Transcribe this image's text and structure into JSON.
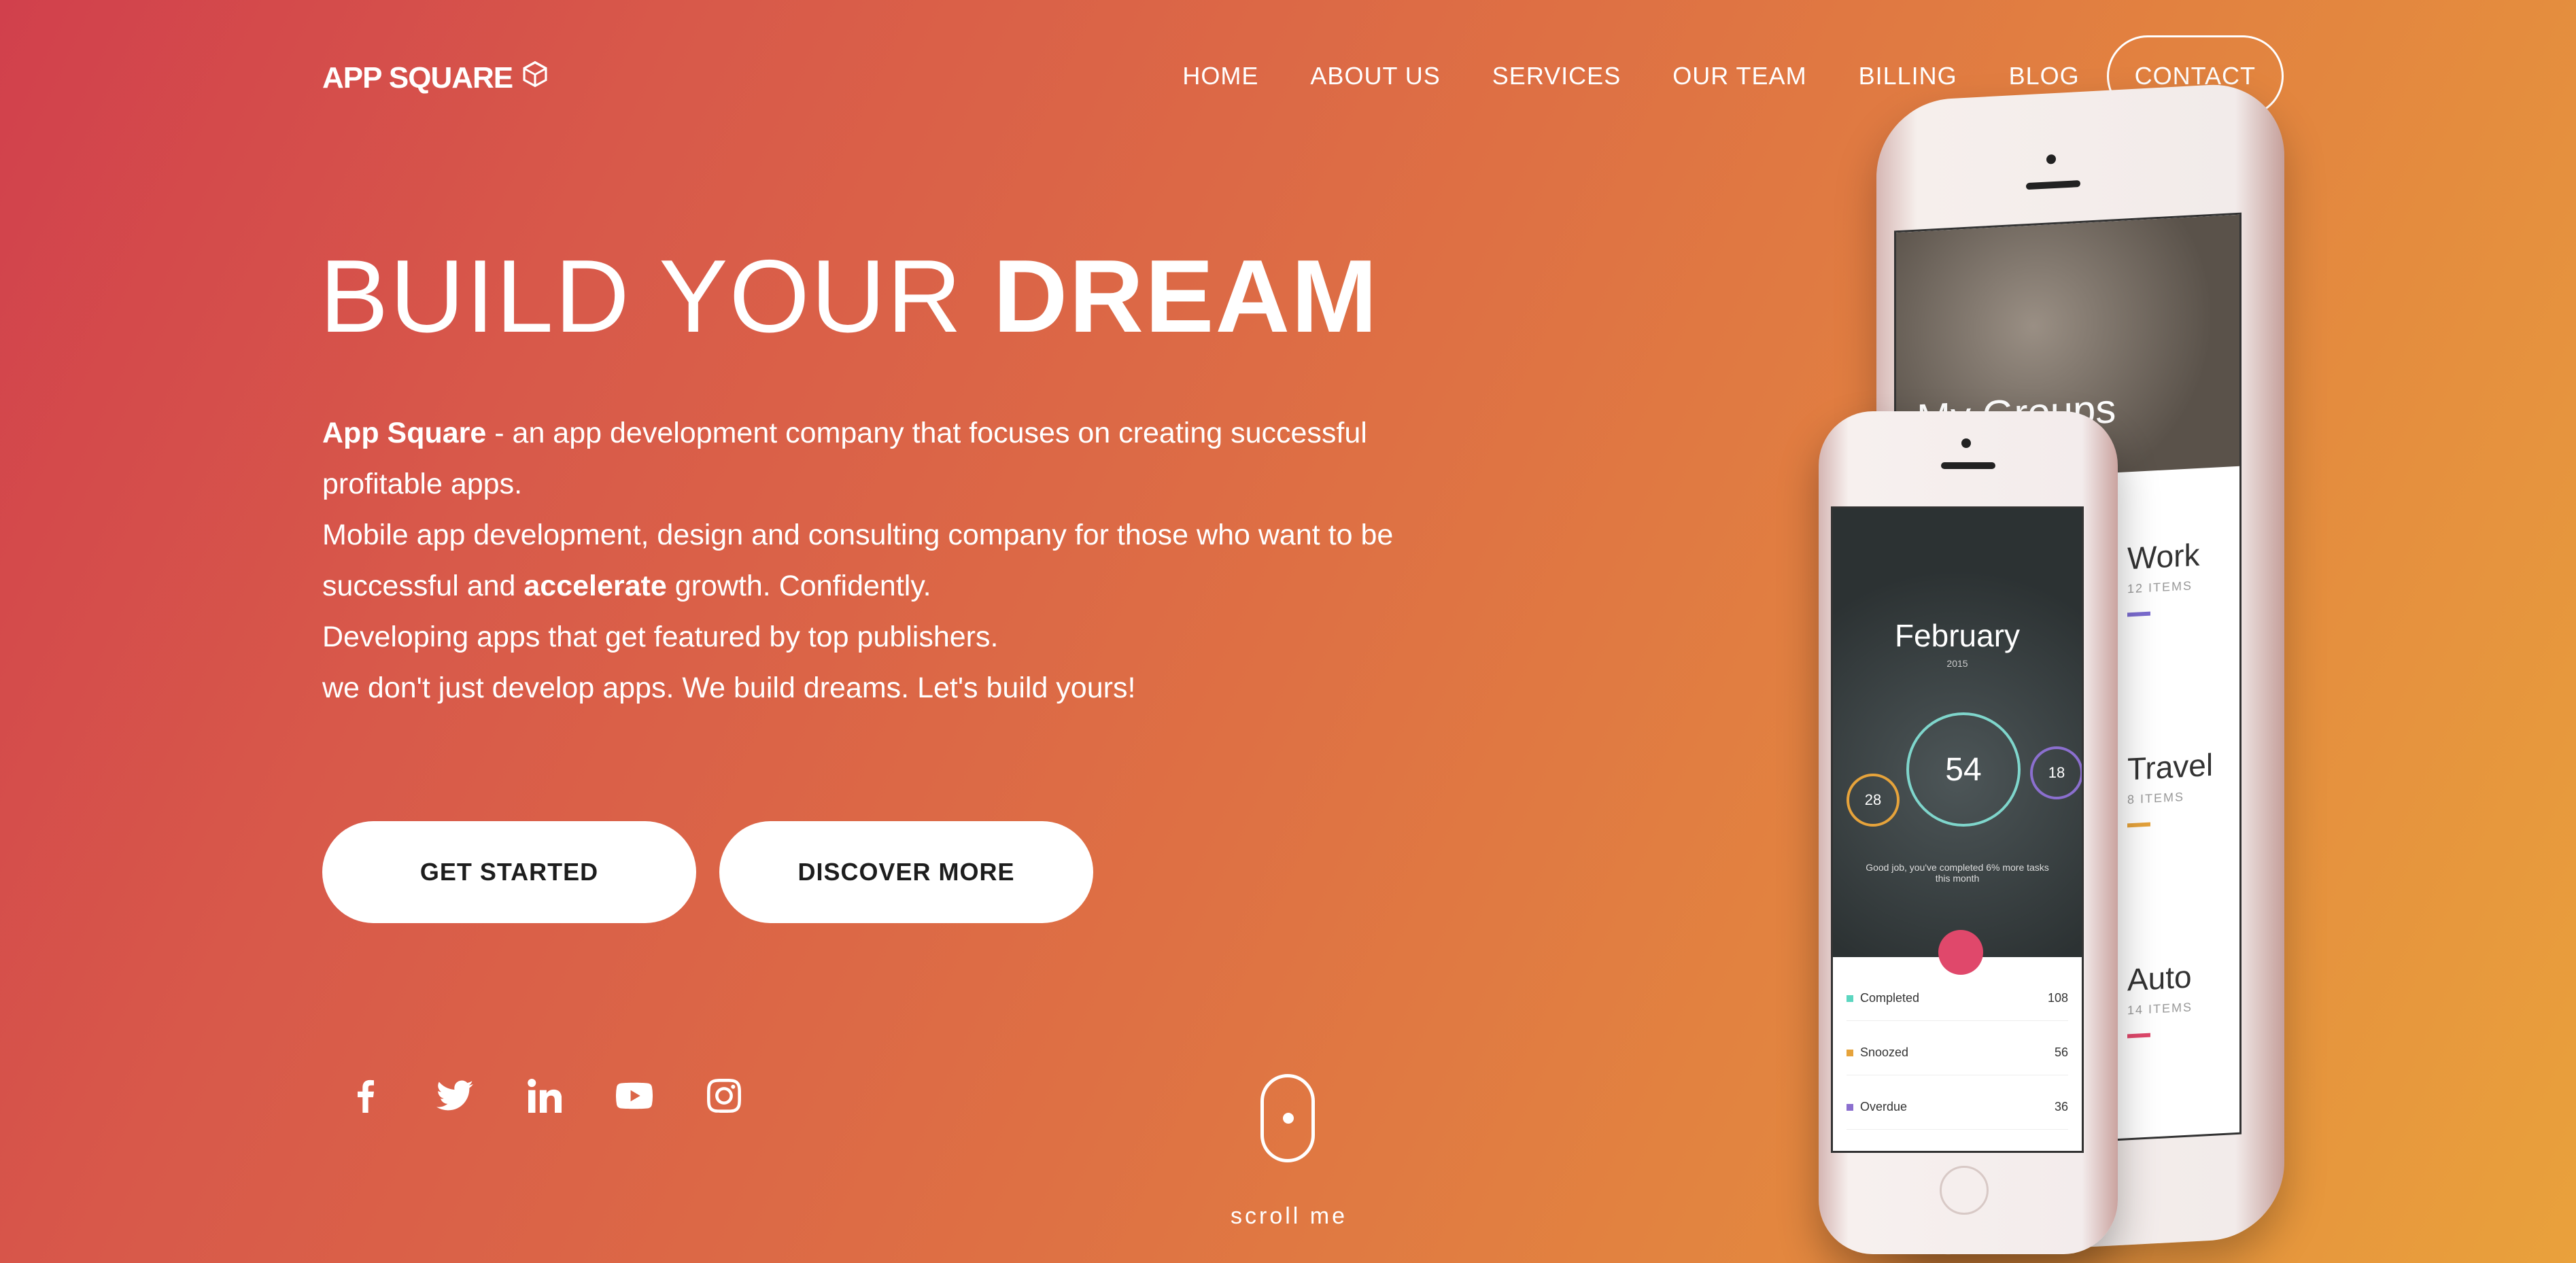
{
  "brand": {
    "name": "APP SQUARE"
  },
  "nav": {
    "items": [
      "HOME",
      "ABOUT US",
      "SERVICES",
      "OUR TEAM",
      "BILLING",
      "BLOG"
    ],
    "contact": "CONTACT"
  },
  "hero": {
    "title_light": "BUILD YOUR ",
    "title_bold": "DREAM",
    "p1_bold": "App Square",
    "p1_rest": " - an app development company that focuses on creating successful profitable apps.",
    "p2_a": "Mobile app development, design and consulting company for those who want to be successful and ",
    "p2_bold": "accelerate",
    "p2_b": " growth. Confidently.",
    "p3": "Developing apps that get featured by top publishers.",
    "p4": "we don't just develop apps. We build dreams. Let's build yours!",
    "btn_primary": "GET STARTED",
    "btn_secondary": "DISCOVER MORE"
  },
  "social": [
    "facebook-icon",
    "twitter-icon",
    "linkedin-icon",
    "youtube-icon",
    "instagram-icon"
  ],
  "scroll": {
    "label": "scroll me"
  },
  "mockup_back": {
    "title": "My Groups",
    "groups": [
      {
        "name": "Work",
        "items": "12 ITEMS",
        "color": "#7b6cd0"
      },
      {
        "name": "Travel",
        "items": "8 ITEMS",
        "color": "#e6a33b"
      },
      {
        "name": "Auto",
        "items": "14 ITEMS",
        "color": "#e0486b"
      }
    ]
  },
  "mockup_front": {
    "month": "February",
    "year": "2015",
    "main_pct": "54",
    "left_pct": "28",
    "right_pct": "18",
    "message": "Good job, you've completed 6% more tasks this month",
    "rows": [
      {
        "label": "Completed",
        "value": "108",
        "color": "#5cd6c0"
      },
      {
        "label": "Snoozed",
        "value": "56",
        "color": "#e6a33b"
      },
      {
        "label": "Overdue",
        "value": "36",
        "color": "#8b6fcf"
      }
    ]
  }
}
